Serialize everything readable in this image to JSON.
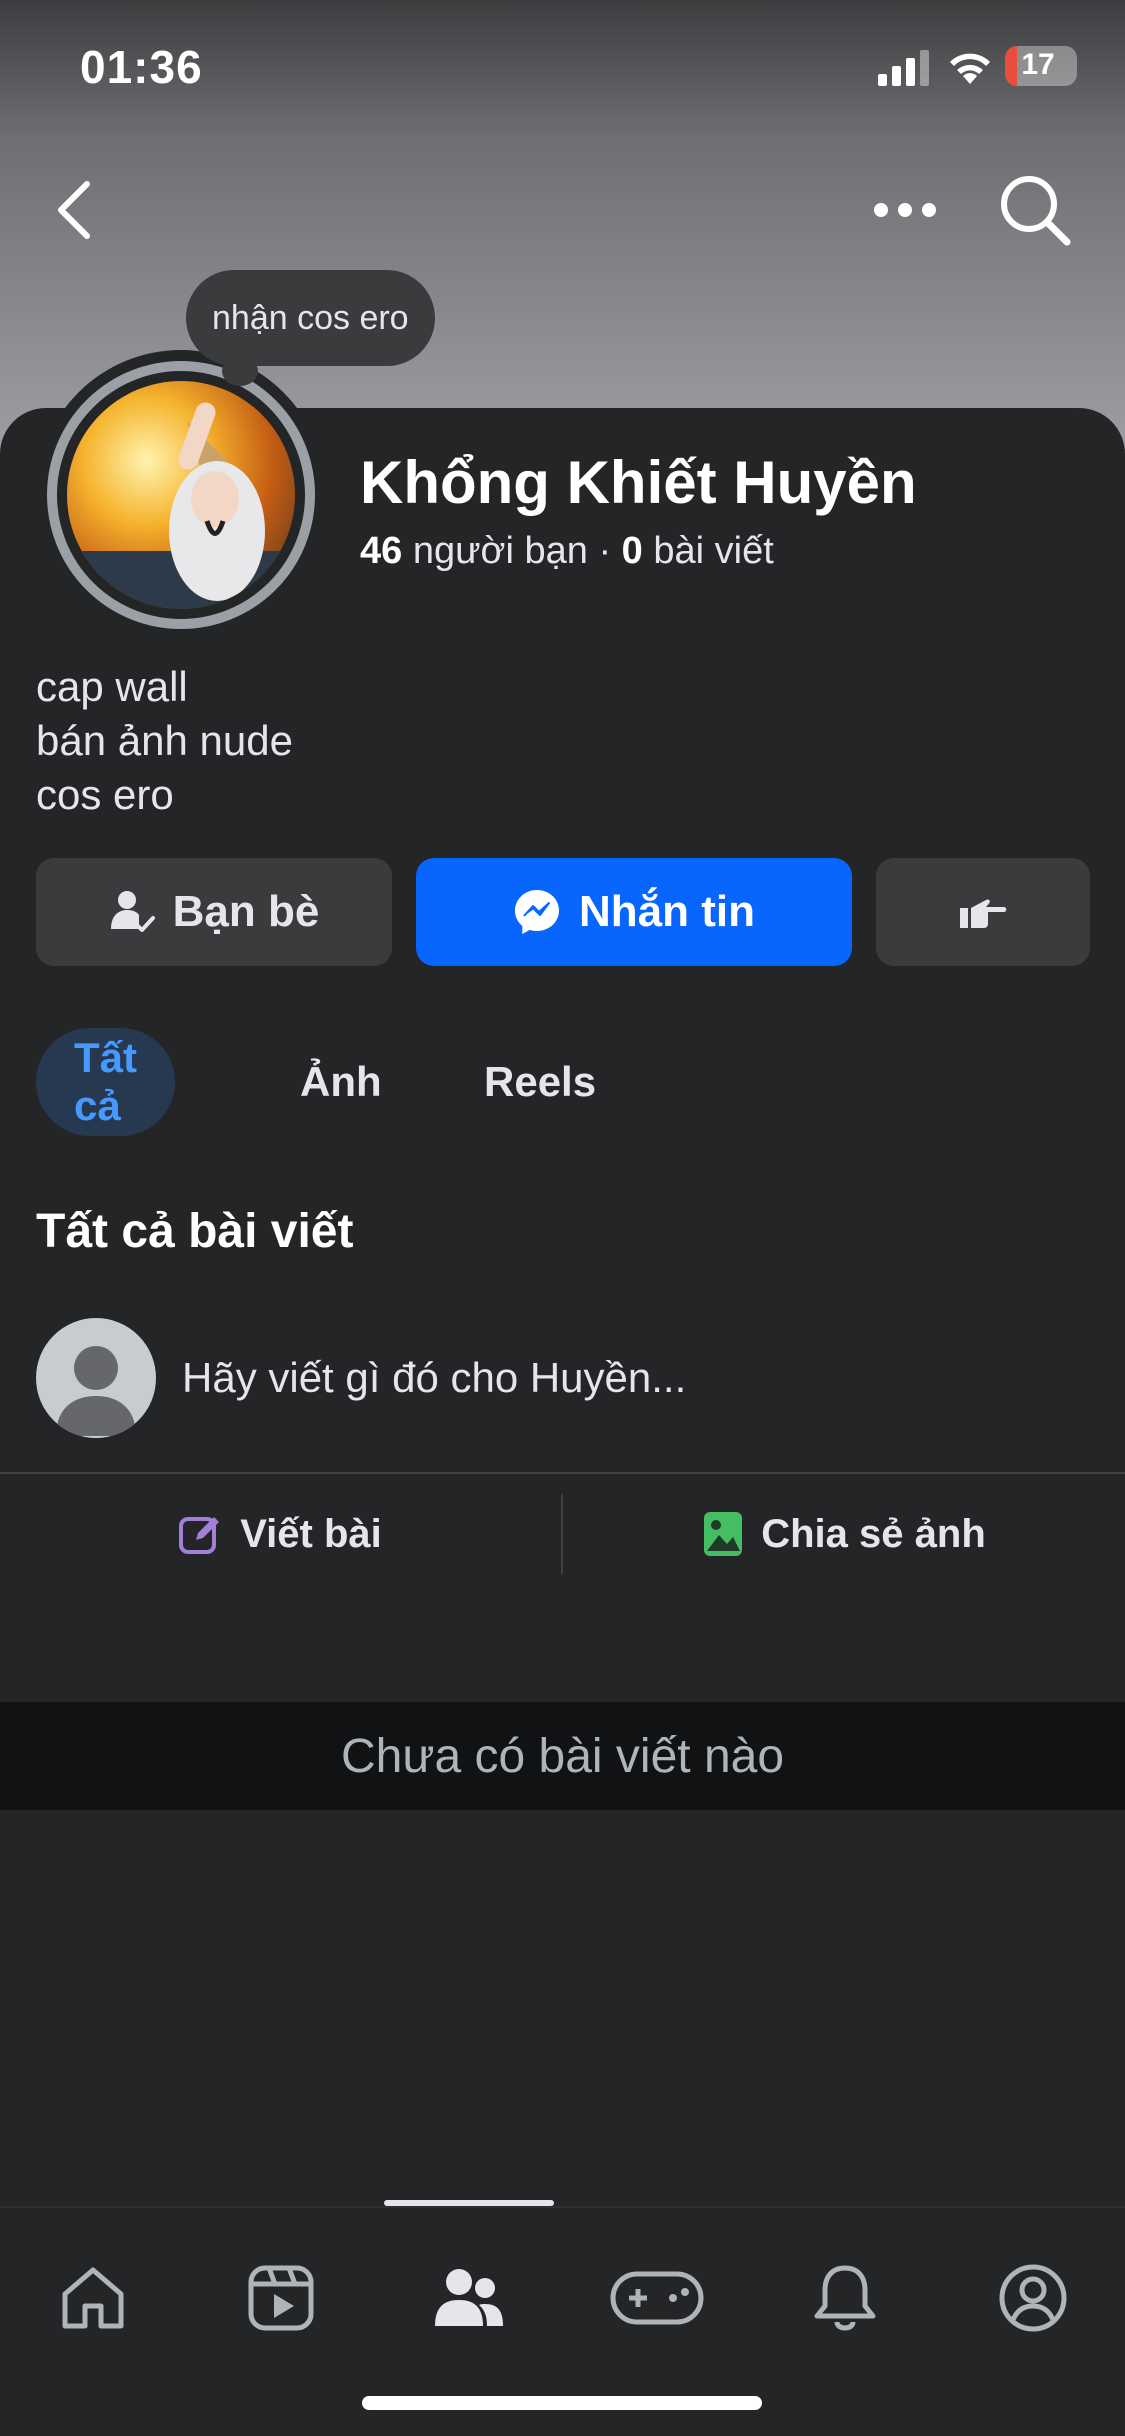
{
  "status_bar": {
    "time": "01:36",
    "battery_level": "17",
    "battery_percent": 17,
    "icons": [
      "signal-icon",
      "wifi-icon",
      "battery-charging-icon"
    ]
  },
  "header": {
    "back_icon": "chevron-left-icon",
    "more_icon": "more-horizontal-icon",
    "search_icon": "search-icon"
  },
  "profile": {
    "note": "nhận cos ero",
    "name": "Khổng Khiết Huyền",
    "friends_count": "46",
    "friends_label": "người bạn",
    "separator": "·",
    "posts_count": "0",
    "posts_label": "bài viết",
    "bio_lines": [
      "cap wall",
      "bán ảnh nude",
      "cos ero"
    ]
  },
  "actions": {
    "friends_label": "Bạn bè",
    "message_label": "Nhắn tin",
    "accent_color": "#0866ff"
  },
  "tabs": [
    {
      "label": "Tất cả",
      "active": true
    },
    {
      "label": "Ảnh",
      "active": false
    },
    {
      "label": "Reels",
      "active": false
    }
  ],
  "posts_section": {
    "title": "Tất cả bài viết",
    "composer_placeholder": "Hãy viết gì đó cho Huyền...",
    "write_label": "Viết bài",
    "share_photo_label": "Chia sẻ ảnh",
    "empty_message": "Chưa có bài viết nào"
  },
  "bottom_nav": {
    "items": [
      "home-icon",
      "video-icon",
      "friends-icon",
      "gaming-icon",
      "notifications-icon",
      "profile-icon"
    ],
    "active_index": 2
  }
}
